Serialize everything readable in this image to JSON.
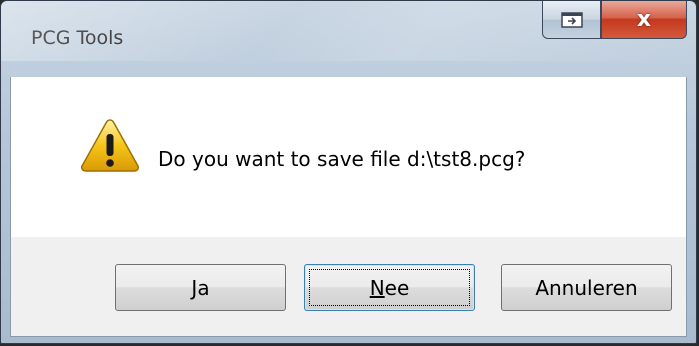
{
  "window": {
    "title": "PCG Tools",
    "close_glyph": "x",
    "restore_icon": "restore-icon"
  },
  "dialog": {
    "icon": "warning-icon",
    "message": "Do you want to save file d:\\tst8.pcg?"
  },
  "buttons": {
    "yes": {
      "accel": "J",
      "rest": "a"
    },
    "no": {
      "accel": "N",
      "rest": "ee"
    },
    "cancel": {
      "label": "Annuleren"
    }
  },
  "colors": {
    "close_button": "#c4381e",
    "warning_fill": "#f5c518",
    "default_button_border": "#3c7fb1"
  }
}
